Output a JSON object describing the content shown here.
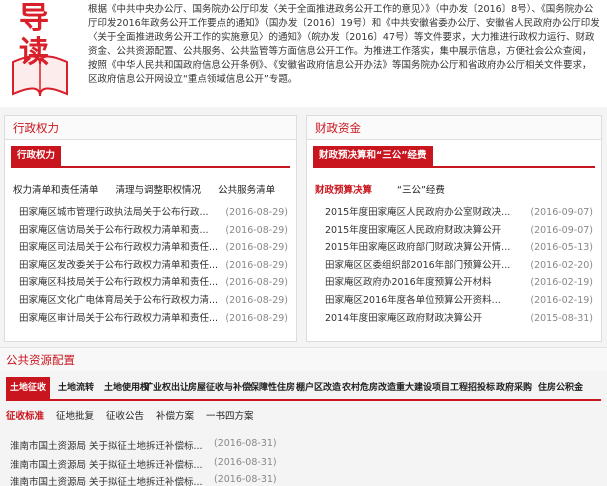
{
  "logo": {
    "char1": "导",
    "char2": "读"
  },
  "intro": {
    "text": "根据《中共中央办公厅、国务院办公厅印发〈关于全面推进政务公开工作的意见〉》（中办发〔2016〕8号）、《国务院办公厅印发2016年政务公开工作要点的通知》（国办发〔2016〕19号）和《中共安徽省委办公厅、安徽省人民政府办公厅印发〈关于全面推进政务公开工作的实施意见〉的通知》（皖办发〔2016〕47号）等文件要求，大力推进行政权力运行、财政资金、公共资源配置、公共服务、公共监管等方面信息公开工作。为推进工作落实，集中展示信息，方便社会公众查阅，按照《中华人民共和国政府信息公开条例》、《安徽省政府信息公开办法》等国务院办公厅和省政府办公厅相关文件要求，区政府信息公开网设立“重点领域信息公开”专题。"
  },
  "left_panel": {
    "title": "行政权力",
    "active_tab": "行政权力",
    "subtabs": [
      "权力清单和责任清单",
      "清理与调整职权情况",
      "公共服务清单"
    ],
    "items": [
      {
        "title": "田家庵区城市管理行政执法局关于公布行政...",
        "date": "(2016-08-29)"
      },
      {
        "title": "田家庵区信访局关于公布行政权力清单和责...",
        "date": "(2016-08-29)"
      },
      {
        "title": "田家庵区司法局关于公布行政权力清单和责任...",
        "date": "(2016-08-29)"
      },
      {
        "title": "田家庵区发改委关于公布行政权力清单和责任...",
        "date": "(2016-08-29)"
      },
      {
        "title": "田家庵区科技局关于公布行政权力清单和责任...",
        "date": "(2016-08-29)"
      },
      {
        "title": "田家庵区文化广电体育局关于公布行政权力清...",
        "date": "(2016-08-29)"
      },
      {
        "title": "田家庵区审计局关于公布行政权力清单和责任...",
        "date": "(2016-08-29)"
      }
    ]
  },
  "right_panel": {
    "title": "财政资金",
    "active_tab": "财政预决算和“三公”经费",
    "subtabs": [
      "财政预算决算",
      "“三公”经费"
    ],
    "items": [
      {
        "title": "2015年度田家庵区人民政府办公室财政决...",
        "date": "(2016-09-07)"
      },
      {
        "title": "2015年度田家庵区人民政府财政决算公开",
        "date": "(2016-09-07)"
      },
      {
        "title": "2015年田家庵区政府部门财政决算公开情...",
        "date": "(2016-05-13)"
      },
      {
        "title": "田家庵区区委组织部2016年部门预算公开...",
        "date": "(2016-02-20)"
      },
      {
        "title": "田家庵区政府办2016年度预算公开材料",
        "date": "(2016-02-19)"
      },
      {
        "title": "田家庵区2016年度各单位预算公开资料...",
        "date": "(2016-02-19)"
      },
      {
        "title": "2014年度田家庵区政府财政决算公开",
        "date": "(2015-08-31)"
      }
    ]
  },
  "public_resources": {
    "title": "公共资源配置",
    "tabs": [
      "土地征收",
      "土地流转",
      "土地使用权",
      "矿业权出让",
      "房屋征收与补偿",
      "保障性住房",
      "棚户区改造",
      "农村危房改造",
      "重大建设项目",
      "工程招投标",
      "政府采购",
      "住房公积金"
    ],
    "subtabs": [
      "征收标准",
      "征地批复",
      "征收公告",
      "补偿方案",
      "一书四方案"
    ],
    "items": [
      {
        "title": "淮南市国土资源局 关于拟征土地拆迁补偿标...",
        "date": "(2016-08-31)"
      },
      {
        "title": "淮南市国土资源局 关于拟征土地拆迁补偿标...",
        "date": "(2016-08-31)"
      },
      {
        "title": "淮南市国土资源局 关于拟征土地拆迁补偿标...",
        "date": "(2016-08-31)"
      }
    ]
  },
  "colors": {
    "accent": "#c9151e",
    "date": "#888888",
    "background": "#f4f4f4"
  }
}
